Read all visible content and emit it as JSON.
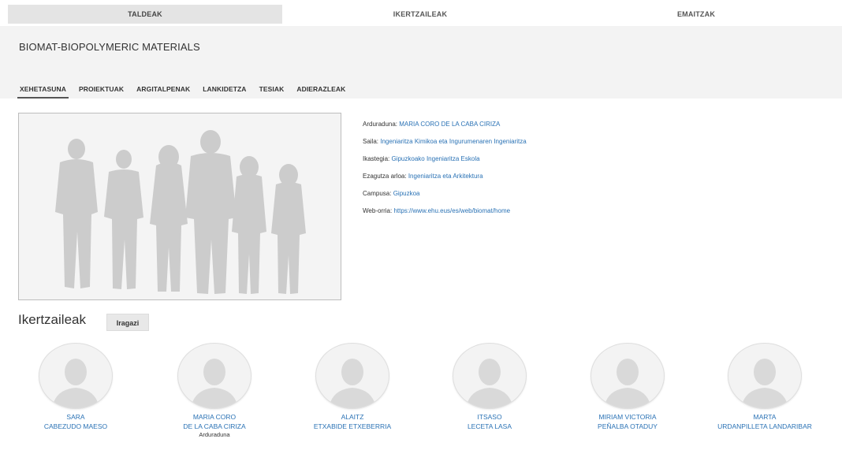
{
  "topnav": {
    "tabs": [
      {
        "label": "TALDEAK",
        "active": true
      },
      {
        "label": "IKERTZAILEAK",
        "active": false
      },
      {
        "label": "EMAITZAK",
        "active": false
      }
    ]
  },
  "group": {
    "title": "BIOMAT-BIOPOLYMERIC MATERIALS",
    "subtabs": [
      "XEHETASUNA",
      "PROIEKTUAK",
      "ARGITALPENAK",
      "LANKIDETZA",
      "TESIAK",
      "ADIERAZLEAK"
    ]
  },
  "details": {
    "rows": [
      {
        "label": "Arduraduna:",
        "value": "MARIA CORO DE LA CABA CIRIZA"
      },
      {
        "label": "Saila:",
        "value": "Ingeniaritza Kimikoa eta Ingurumenaren Ingeniaritza"
      },
      {
        "label": "Ikastegia:",
        "value": "Gipuzkoako Ingeniaritza Eskola"
      },
      {
        "label": "Ezagutza arloa:",
        "value": "Ingeniaritza eta Arkitektura"
      },
      {
        "label": "Campusa:",
        "value": "Gipuzkoa"
      },
      {
        "label": "Web-orria:",
        "value": "https://www.ehu.eus/es/web/biomat/home"
      }
    ]
  },
  "researchers": {
    "heading": "Ikertzaileak",
    "filter_label": "Iragazi",
    "items": [
      {
        "line1": "SARA",
        "line2": "CABEZUDO MAESO",
        "role": ""
      },
      {
        "line1": "MARIA CORO",
        "line2": "DE LA CABA CIRIZA",
        "role": "Arduraduna"
      },
      {
        "line1": "ALAITZ",
        "line2": "ETXABIDE ETXEBERRIA",
        "role": ""
      },
      {
        "line1": "ITSASO",
        "line2": "LECETA LASA",
        "role": ""
      },
      {
        "line1": "MIRIAM VICTORIA",
        "line2": "PEÑALBA OTADUY",
        "role": ""
      },
      {
        "line1": "MARTA",
        "line2": "URDANPILLETA LANDARIBAR",
        "role": ""
      }
    ]
  },
  "colors": {
    "link": "#2a72b5",
    "band": "#f3f3f3",
    "active_tab": "#e4e4e4",
    "silhouette": "#cccccc"
  }
}
